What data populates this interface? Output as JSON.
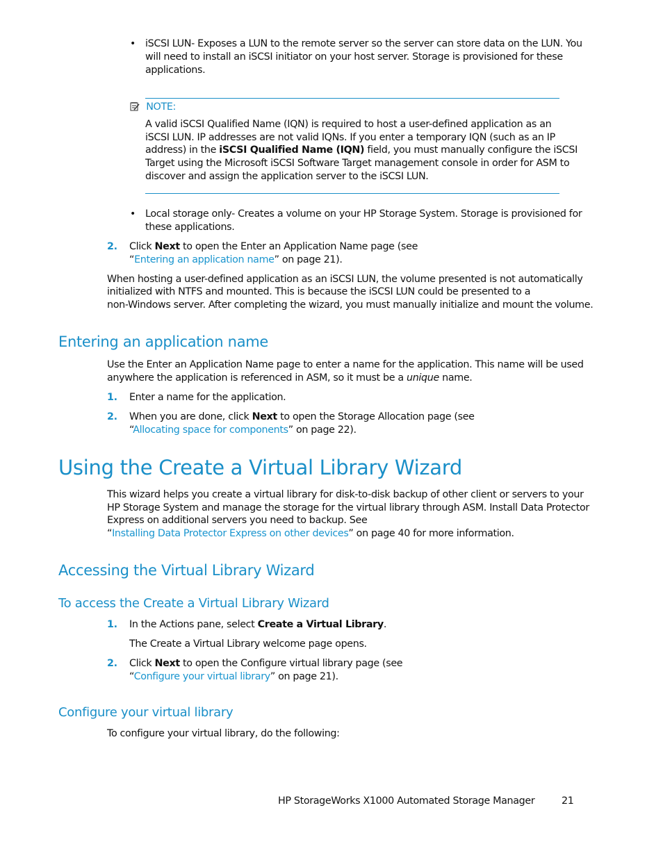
{
  "bullets_top": [
    {
      "lines": [
        "iSCSI LUN- Exposes a LUN to the remote server so the server can store data on the LUN. You",
        "will need to install an iSCSI initiator on your host server. Storage is provisioned for these",
        "applications."
      ]
    }
  ],
  "note": {
    "icon": "note-icon",
    "label": "NOTE:",
    "line1": "A valid iSCSI Qualified Name (IQN) is required to host a user-defined application as an",
    "line2": "iSCSI LUN. IP addresses are not valid IQNs. If you enter a temporary IQN (such as an IP",
    "line3_pre": "address) in the ",
    "line3_bold": "iSCSI Qualified Name (IQN)",
    "line3_post": " field, you must manually configure the iSCSI",
    "line4": "Target using the Microsoft iSCSI Software Target management console in order for ASM to",
    "line5": "discover and assign the application server to the iSCSI LUN."
  },
  "bullet_local": {
    "line1": "Local storage only- Creates a volume on your HP Storage System. Storage is provisioned for",
    "line2": "these applications."
  },
  "step2_top": {
    "num": "2.",
    "pre": "Click ",
    "bold": "Next",
    "post": " to open the Enter an Application Name page (see",
    "quote_open": "“",
    "link": "Entering an application name",
    "suffix": "” on page 21)."
  },
  "para_hosting": [
    "When hosting a user-defined application as an iSCSI LUN, the volume presented is not automatically",
    "initialized with NTFS and mounted. This is because the iSCSI LUN could be presented to a",
    "non-Windows server. After completing the wizard, you must manually initialize and mount the volume."
  ],
  "section_entering": {
    "heading": "Entering an application name",
    "para_line1": "Use the Enter an Application Name page to enter a name for the application. This name will be used",
    "para_line2_pre": "anywhere the application is referenced in ASM, so it must be a ",
    "para_line2_italic": "unique",
    "para_line2_post": " name.",
    "step1_num": "1.",
    "step1": "Enter a name for the application.",
    "step2_num": "2.",
    "step2_pre": "When you are done, click ",
    "step2_bold": "Next",
    "step2_post": " to open the Storage Allocation page (see",
    "step2_quote_open": "“",
    "step2_link": "Allocating space for components",
    "step2_suffix": "” on page 22)."
  },
  "section_using": {
    "heading": "Using the Create a Virtual Library Wizard",
    "lines": [
      "This wizard helps you create a virtual library for disk-to-disk backup of other client or servers to your",
      "HP Storage System and manage the storage for the virtual library through ASM. Install Data Protector",
      "Express on additional servers you need to backup. See"
    ],
    "quote_open": "“",
    "link": "Installing Data Protector Express on other devices",
    "suffix": "” on page 40 for more information."
  },
  "section_accessing": {
    "heading": "Accessing the Virtual Library Wizard",
    "subheading": "To access the Create a Virtual Library Wizard",
    "step1_num": "1.",
    "step1_pre": "In the Actions pane, select ",
    "step1_bold": "Create a Virtual Library",
    "step1_post": ".",
    "step1_result": "The Create a Virtual Library welcome page opens.",
    "step2_num": "2.",
    "step2_pre": "Click ",
    "step2_bold": "Next",
    "step2_post": " to open the Configure virtual library page (see",
    "step2_quote_open": "“",
    "step2_link": "Configure your virtual library",
    "step2_suffix": "” on page 21)."
  },
  "section_configure": {
    "heading": "Configure your virtual library",
    "para": "To configure your virtual library, do the following:"
  },
  "footer": {
    "title": "HP StorageWorks X1000 Automated Storage Manager",
    "page_number": "21"
  },
  "colors": {
    "accent": "#1a8fc8",
    "text": "#111111"
  }
}
